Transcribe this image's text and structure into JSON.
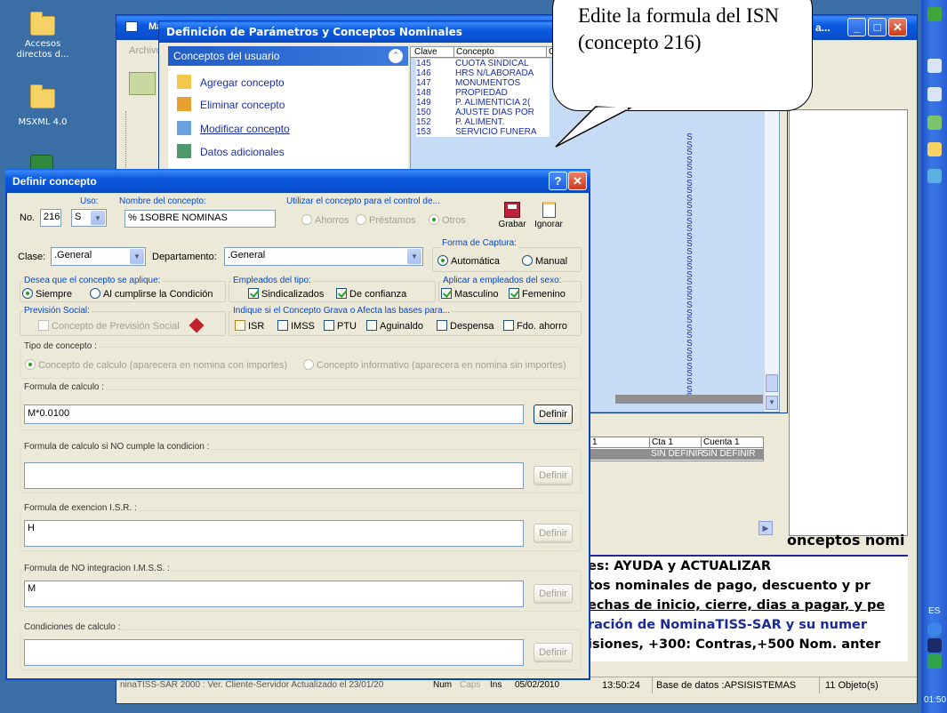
{
  "desktop": {
    "icons": [
      {
        "label": "Accesos directos d...",
        "icon": "folder-icon"
      },
      {
        "label": "",
        "icon": "folder-icon"
      },
      {
        "label": "MSXML 4.0",
        "icon": "folder-icon"
      }
    ]
  },
  "taskbar": {
    "lang": "ES",
    "clock": "01:50"
  },
  "bg_window": {
    "title": "Ma",
    "menu_first": "Archivo",
    "title2": "a...",
    "heading_text": "onceptos nomi",
    "text_lines": [
      "es: AYUDA y ACTUALIZAR",
      "tos nominales de pago, descuento y pr",
      "echas de inicio, cierre, dias a pagar, y pe",
      "ración de NominaTISS-SAR y su numer",
      "isiones, +300: Contras,+500 Nom. anter"
    ],
    "grid": {
      "headers": [
        "1",
        "Cta 1",
        "Cuenta 1"
      ],
      "row": [
        "",
        "SIN DEFINIR",
        "SIN DEFINIR"
      ]
    },
    "status": {
      "app": "ninaTISS-SAR 2000 : Ver. Cliente-Servidor Actualizado el 23/01/20",
      "num": "Num",
      "caps": "Caps",
      "ins": "Ins",
      "date": "05/02/2010",
      "time": "13:50:24",
      "db": "Base de datos :APSISISTEMAS",
      "objects": "11 Objeto(s)"
    }
  },
  "params_window": {
    "title": "Definición de Parámetros y Conceptos Nominales",
    "panel_title": "Conceptos del usuario",
    "tasks": [
      "Agregar concepto",
      "Eliminar concepto",
      "Modificar concepto",
      "Datos adicionales"
    ],
    "list_headers": [
      "Clave",
      "Concepto",
      "C"
    ],
    "list_rows": [
      [
        "145",
        "CUOTA SINDICAL"
      ],
      [
        "146",
        "HRS N/LABORADA"
      ],
      [
        "147",
        "MONUMENTOS"
      ],
      [
        "148",
        "PROPIEDAD"
      ],
      [
        "149",
        "P. ALIMENTICIA 2("
      ],
      [
        "150",
        "AJUSTE DIAS POR"
      ],
      [
        "152",
        "P. ALIMENT."
      ],
      [
        "153",
        "SERVICIO FUNERA"
      ]
    ],
    "s_value": "S"
  },
  "callout": {
    "text": "Edite la formula del ISN (concepto 216)"
  },
  "dialog": {
    "title": "Definir concepto",
    "help": "?",
    "close": "✕",
    "no_label": "No.",
    "no_value": "216",
    "uso_label": "Uso:",
    "uso_value": "S",
    "nombre_label": "Nombre del concepto:",
    "nombre_value": "% 1SOBRE NOMINAS",
    "utilizar_label": "Utilizar el concepto para el control de...",
    "control_opts": [
      "Ahorros",
      "Préstamos",
      "Otros"
    ],
    "grabar": "Grabar",
    "ignorar": "Ignorar",
    "clase_label": "Clase:",
    "clase_value": ".General",
    "depto_label": "Departamento:",
    "depto_value": ".General",
    "captura_label": "Forma de Captura:",
    "captura_opts": [
      "Automática",
      "Manual"
    ],
    "aplique_label": "Desea que el concepto se aplique:",
    "aplique_opts": [
      "Siempre",
      "Al cumplirse la Condición"
    ],
    "empleados_label": "Empleados del tipo:",
    "empleados_opts": [
      "Sindicalizados",
      "De confianza"
    ],
    "sexo_label": "Aplicar a empleados del sexo:",
    "sexo_opts": [
      "Masculino",
      "Femenino"
    ],
    "prevision_label": "Previsión Social:",
    "prevision_opt": "Concepto de Previsión Social",
    "grava_label": "Indique si el Concepto Grava o Afecta las bases para...",
    "grava_opts": [
      "ISR",
      "IMSS",
      "PTU",
      "Aguinaldo",
      "Despensa",
      "Fdo. ahorro"
    ],
    "tipo_label": "Tipo de concepto :",
    "tipo_opts": [
      "Concepto de calculo (aparecera en nomina con importes)",
      "Concepto informativo (aparecera en nomina sin importes)"
    ],
    "formulas": [
      {
        "label": "Formula de calculo :",
        "value": "M*0.0100",
        "button": "Definir",
        "enabled": true
      },
      {
        "label": "Formula de calculo si NO cumple la condicion :",
        "value": "",
        "button": "Definir",
        "enabled": false
      },
      {
        "label": "Formula de exencion  I.S.R. :",
        "value": "H",
        "button": "Definir",
        "enabled": false
      },
      {
        "label": "Formula de NO integracion I.M.S.S. :",
        "value": "M",
        "button": "Definir",
        "enabled": false
      },
      {
        "label": "Condiciones de calculo :",
        "value": "",
        "button": "Definir",
        "enabled": false
      }
    ]
  }
}
